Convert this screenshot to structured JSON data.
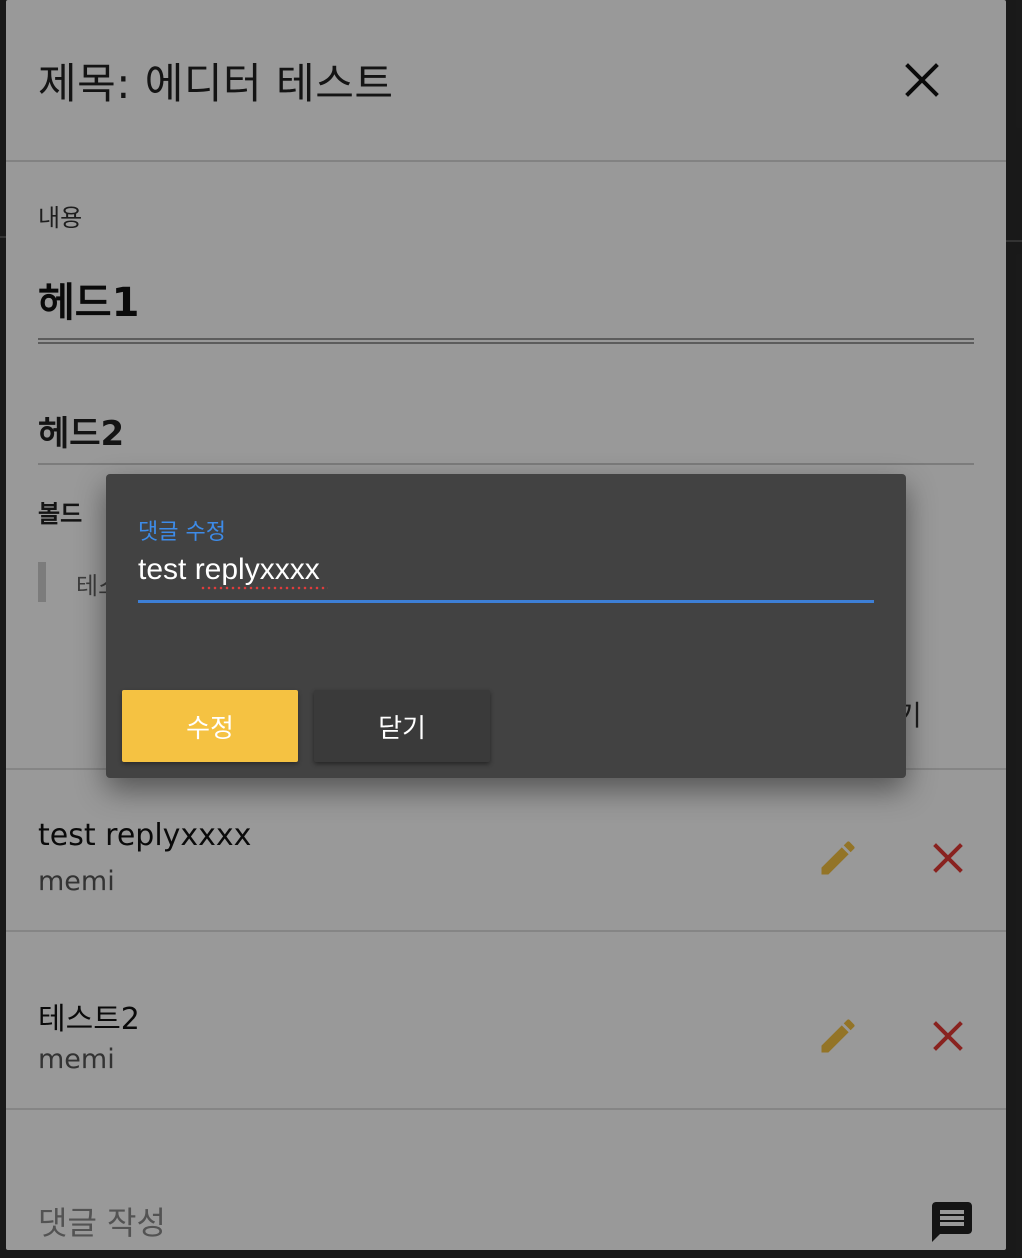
{
  "modal": {
    "title": "제목: 에디터 테스트",
    "content_label": "내용",
    "content": {
      "heading1": "헤드1",
      "heading2": "헤드2",
      "bold_text": "볼드",
      "quote_text": "테스",
      "hidden_button_tail": "기"
    },
    "comments": [
      {
        "text": "test replyxxxx",
        "author": "memi"
      },
      {
        "text": "테스트2",
        "author": "memi"
      }
    ],
    "write_comment_placeholder": "댓글 작성"
  },
  "edit_dialog": {
    "field_label": "댓글 수정",
    "field_value": "test replyxxxx",
    "submit_label": "수정",
    "close_label": "닫기"
  },
  "colors": {
    "accent_blue": "#3d8be8",
    "primary_button": "#f5c242",
    "edit_icon": "#f5c242",
    "delete_icon": "#e53935",
    "dialog_bg": "#424242"
  },
  "icons": {
    "close": "close-icon",
    "edit": "pencil-icon",
    "delete": "delete-x-icon",
    "chat": "chat-icon"
  }
}
